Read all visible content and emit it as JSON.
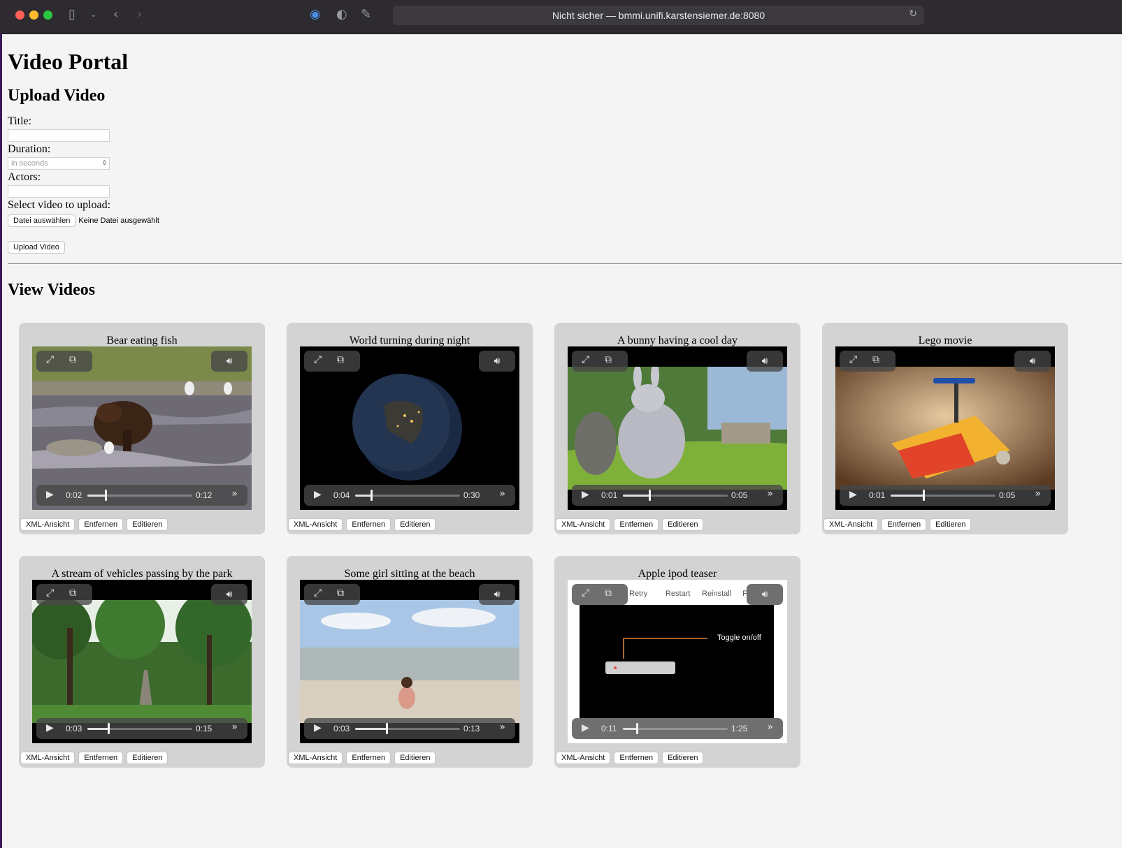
{
  "browser": {
    "url": "Nicht sicher — bmmi.unifi.karstensiemer.de:8080",
    "icons": [
      "sidebar-icon",
      "chevron-down-icon",
      "back-icon",
      "forward-icon",
      "password-manager-icon",
      "shield-icon",
      "extension-icon",
      "reload-icon"
    ]
  },
  "page": {
    "title": "Video Portal",
    "upload": {
      "heading": "Upload Video",
      "title_label": "Title:",
      "title_value": "",
      "duration_label": "Duration:",
      "duration_placeholder": "in seconds",
      "actors_label": "Actors:",
      "actors_value": "",
      "file_label": "Select video to upload:",
      "file_button": "Datei auswählen",
      "file_status": "Keine Datei ausgewählt",
      "submit": "Upload Video"
    },
    "view": {
      "heading": "View Videos"
    }
  },
  "card_buttons": {
    "xml": "XML-Ansicht",
    "remove": "Entfernen",
    "edit": "Editieren"
  },
  "videos": [
    {
      "title": "Bear eating fish",
      "current_time": "0:02",
      "duration": "0:12",
      "progress": 0.17,
      "scene": "river-bear",
      "letterbox": false
    },
    {
      "title": "World turning during night",
      "current_time": "0:04",
      "duration": "0:30",
      "progress": 0.15,
      "scene": "earth-night",
      "letterbox": true
    },
    {
      "title": "A bunny having a cool day",
      "current_time": "0:01",
      "duration": "0:05",
      "progress": 0.25,
      "scene": "cartoon-bunny",
      "letterbox": true
    },
    {
      "title": "Lego movie",
      "current_time": "0:01",
      "duration": "0:05",
      "progress": 0.31,
      "scene": "lego-model",
      "letterbox": false
    },
    {
      "title": "A stream of vehicles passing by the park",
      "current_time": "0:03",
      "duration": "0:15",
      "progress": 0.2,
      "scene": "park-path",
      "letterbox": true
    },
    {
      "title": "Some girl sitting at the beach",
      "current_time": "0:03",
      "duration": "0:13",
      "progress": 0.3,
      "scene": "beach-girl",
      "letterbox": true
    },
    {
      "title": "Apple ipod teaser",
      "current_time": "0:11",
      "duration": "1:25",
      "progress": 0.13,
      "scene": "ipod-teaser",
      "letterbox": false,
      "overlay_menu": [
        "Retry",
        "Restart",
        "Reinstall",
        "F"
      ],
      "overlay_label": "Toggle on/off"
    }
  ]
}
